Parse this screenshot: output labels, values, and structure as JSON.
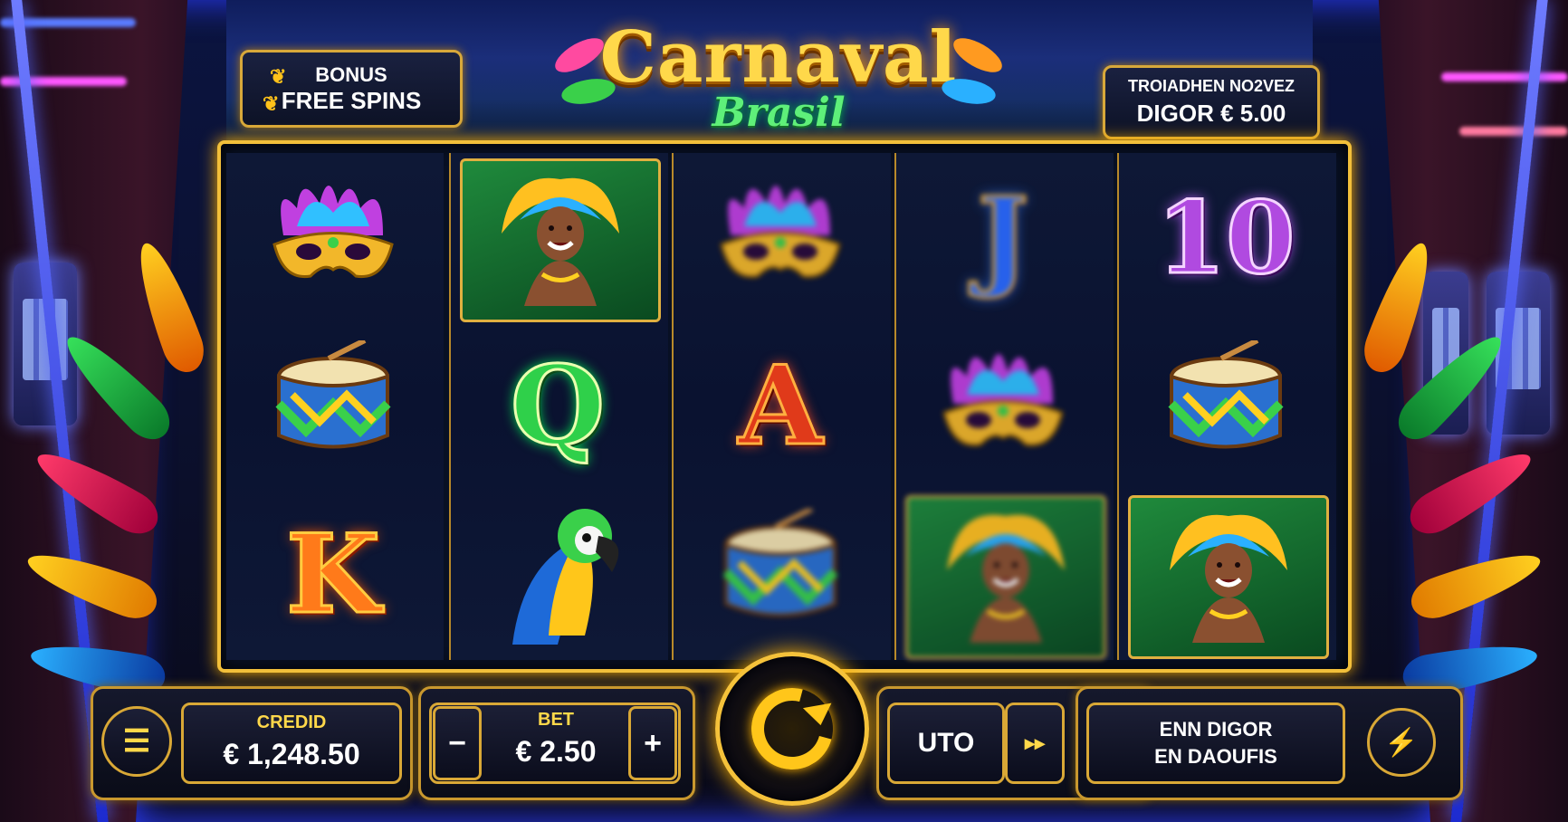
{
  "game": {
    "title": "Carnaval",
    "subtitle": "Brasil"
  },
  "bonus": {
    "line1": "BONUS",
    "line2": "FREE SPINS"
  },
  "jackpot": {
    "line1": "TROIADHEN NO2VEZ",
    "line2": "DIGOR € 5.00"
  },
  "reels": [
    [
      {
        "symbol": "mask-icon"
      },
      {
        "symbol": "drum-icon"
      },
      {
        "symbol": "letter",
        "text": "K",
        "cls": "k"
      }
    ],
    [
      {
        "symbol": "dancer-icon"
      },
      {
        "symbol": "letter",
        "text": "Q",
        "cls": "q"
      },
      {
        "symbol": "parrot-icon"
      }
    ],
    [
      {
        "symbol": "mask-icon",
        "blur": true
      },
      {
        "symbol": "letter",
        "text": "A",
        "cls": "a"
      },
      {
        "symbol": "drum-icon",
        "blur": true
      }
    ],
    [
      {
        "symbol": "letter",
        "text": "J",
        "cls": "j",
        "blur": true
      },
      {
        "symbol": "mask-icon",
        "blur": true
      },
      {
        "symbol": "dancer-icon",
        "blur": true
      }
    ],
    [
      {
        "symbol": "letter",
        "text": "10",
        "cls": "ten"
      },
      {
        "symbol": "drum-icon"
      },
      {
        "symbol": "dancer-icon"
      }
    ]
  ],
  "controls": {
    "credit_label": "CREDID",
    "credit_value": "€ 1,248.50",
    "bet_label": "BET",
    "bet_value": "€ 2.50",
    "bet_minus": "−",
    "bet_plus": "+",
    "auto_label": "UTO",
    "fast_label": "▸▸",
    "menu_icon": "☰",
    "bolt_icon": "⚡",
    "info_line1": "ENN DIGOR",
    "info_line2": "EN DAOUFIS"
  },
  "colors": {
    "gold": "#f2bf3a",
    "accent_yellow": "#ffd84a",
    "logo_green": "#5ef07a"
  }
}
